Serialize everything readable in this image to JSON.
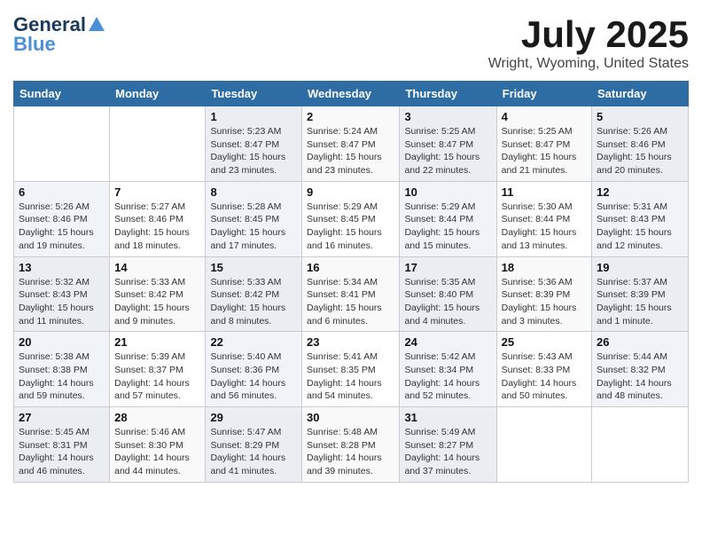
{
  "logo": {
    "line1": "General",
    "line2": "Blue"
  },
  "title": {
    "month": "July 2025",
    "location": "Wright, Wyoming, United States"
  },
  "weekdays": [
    "Sunday",
    "Monday",
    "Tuesday",
    "Wednesday",
    "Thursday",
    "Friday",
    "Saturday"
  ],
  "weeks": [
    [
      {
        "day": "",
        "sunrise": "",
        "sunset": "",
        "daylight": ""
      },
      {
        "day": "",
        "sunrise": "",
        "sunset": "",
        "daylight": ""
      },
      {
        "day": "1",
        "sunrise": "Sunrise: 5:23 AM",
        "sunset": "Sunset: 8:47 PM",
        "daylight": "Daylight: 15 hours and 23 minutes."
      },
      {
        "day": "2",
        "sunrise": "Sunrise: 5:24 AM",
        "sunset": "Sunset: 8:47 PM",
        "daylight": "Daylight: 15 hours and 23 minutes."
      },
      {
        "day": "3",
        "sunrise": "Sunrise: 5:25 AM",
        "sunset": "Sunset: 8:47 PM",
        "daylight": "Daylight: 15 hours and 22 minutes."
      },
      {
        "day": "4",
        "sunrise": "Sunrise: 5:25 AM",
        "sunset": "Sunset: 8:47 PM",
        "daylight": "Daylight: 15 hours and 21 minutes."
      },
      {
        "day": "5",
        "sunrise": "Sunrise: 5:26 AM",
        "sunset": "Sunset: 8:46 PM",
        "daylight": "Daylight: 15 hours and 20 minutes."
      }
    ],
    [
      {
        "day": "6",
        "sunrise": "Sunrise: 5:26 AM",
        "sunset": "Sunset: 8:46 PM",
        "daylight": "Daylight: 15 hours and 19 minutes."
      },
      {
        "day": "7",
        "sunrise": "Sunrise: 5:27 AM",
        "sunset": "Sunset: 8:46 PM",
        "daylight": "Daylight: 15 hours and 18 minutes."
      },
      {
        "day": "8",
        "sunrise": "Sunrise: 5:28 AM",
        "sunset": "Sunset: 8:45 PM",
        "daylight": "Daylight: 15 hours and 17 minutes."
      },
      {
        "day": "9",
        "sunrise": "Sunrise: 5:29 AM",
        "sunset": "Sunset: 8:45 PM",
        "daylight": "Daylight: 15 hours and 16 minutes."
      },
      {
        "day": "10",
        "sunrise": "Sunrise: 5:29 AM",
        "sunset": "Sunset: 8:44 PM",
        "daylight": "Daylight: 15 hours and 15 minutes."
      },
      {
        "day": "11",
        "sunrise": "Sunrise: 5:30 AM",
        "sunset": "Sunset: 8:44 PM",
        "daylight": "Daylight: 15 hours and 13 minutes."
      },
      {
        "day": "12",
        "sunrise": "Sunrise: 5:31 AM",
        "sunset": "Sunset: 8:43 PM",
        "daylight": "Daylight: 15 hours and 12 minutes."
      }
    ],
    [
      {
        "day": "13",
        "sunrise": "Sunrise: 5:32 AM",
        "sunset": "Sunset: 8:43 PM",
        "daylight": "Daylight: 15 hours and 11 minutes."
      },
      {
        "day": "14",
        "sunrise": "Sunrise: 5:33 AM",
        "sunset": "Sunset: 8:42 PM",
        "daylight": "Daylight: 15 hours and 9 minutes."
      },
      {
        "day": "15",
        "sunrise": "Sunrise: 5:33 AM",
        "sunset": "Sunset: 8:42 PM",
        "daylight": "Daylight: 15 hours and 8 minutes."
      },
      {
        "day": "16",
        "sunrise": "Sunrise: 5:34 AM",
        "sunset": "Sunset: 8:41 PM",
        "daylight": "Daylight: 15 hours and 6 minutes."
      },
      {
        "day": "17",
        "sunrise": "Sunrise: 5:35 AM",
        "sunset": "Sunset: 8:40 PM",
        "daylight": "Daylight: 15 hours and 4 minutes."
      },
      {
        "day": "18",
        "sunrise": "Sunrise: 5:36 AM",
        "sunset": "Sunset: 8:39 PM",
        "daylight": "Daylight: 15 hours and 3 minutes."
      },
      {
        "day": "19",
        "sunrise": "Sunrise: 5:37 AM",
        "sunset": "Sunset: 8:39 PM",
        "daylight": "Daylight: 15 hours and 1 minute."
      }
    ],
    [
      {
        "day": "20",
        "sunrise": "Sunrise: 5:38 AM",
        "sunset": "Sunset: 8:38 PM",
        "daylight": "Daylight: 14 hours and 59 minutes."
      },
      {
        "day": "21",
        "sunrise": "Sunrise: 5:39 AM",
        "sunset": "Sunset: 8:37 PM",
        "daylight": "Daylight: 14 hours and 57 minutes."
      },
      {
        "day": "22",
        "sunrise": "Sunrise: 5:40 AM",
        "sunset": "Sunset: 8:36 PM",
        "daylight": "Daylight: 14 hours and 56 minutes."
      },
      {
        "day": "23",
        "sunrise": "Sunrise: 5:41 AM",
        "sunset": "Sunset: 8:35 PM",
        "daylight": "Daylight: 14 hours and 54 minutes."
      },
      {
        "day": "24",
        "sunrise": "Sunrise: 5:42 AM",
        "sunset": "Sunset: 8:34 PM",
        "daylight": "Daylight: 14 hours and 52 minutes."
      },
      {
        "day": "25",
        "sunrise": "Sunrise: 5:43 AM",
        "sunset": "Sunset: 8:33 PM",
        "daylight": "Daylight: 14 hours and 50 minutes."
      },
      {
        "day": "26",
        "sunrise": "Sunrise: 5:44 AM",
        "sunset": "Sunset: 8:32 PM",
        "daylight": "Daylight: 14 hours and 48 minutes."
      }
    ],
    [
      {
        "day": "27",
        "sunrise": "Sunrise: 5:45 AM",
        "sunset": "Sunset: 8:31 PM",
        "daylight": "Daylight: 14 hours and 46 minutes."
      },
      {
        "day": "28",
        "sunrise": "Sunrise: 5:46 AM",
        "sunset": "Sunset: 8:30 PM",
        "daylight": "Daylight: 14 hours and 44 minutes."
      },
      {
        "day": "29",
        "sunrise": "Sunrise: 5:47 AM",
        "sunset": "Sunset: 8:29 PM",
        "daylight": "Daylight: 14 hours and 41 minutes."
      },
      {
        "day": "30",
        "sunrise": "Sunrise: 5:48 AM",
        "sunset": "Sunset: 8:28 PM",
        "daylight": "Daylight: 14 hours and 39 minutes."
      },
      {
        "day": "31",
        "sunrise": "Sunrise: 5:49 AM",
        "sunset": "Sunset: 8:27 PM",
        "daylight": "Daylight: 14 hours and 37 minutes."
      },
      {
        "day": "",
        "sunrise": "",
        "sunset": "",
        "daylight": ""
      },
      {
        "day": "",
        "sunrise": "",
        "sunset": "",
        "daylight": ""
      }
    ]
  ]
}
